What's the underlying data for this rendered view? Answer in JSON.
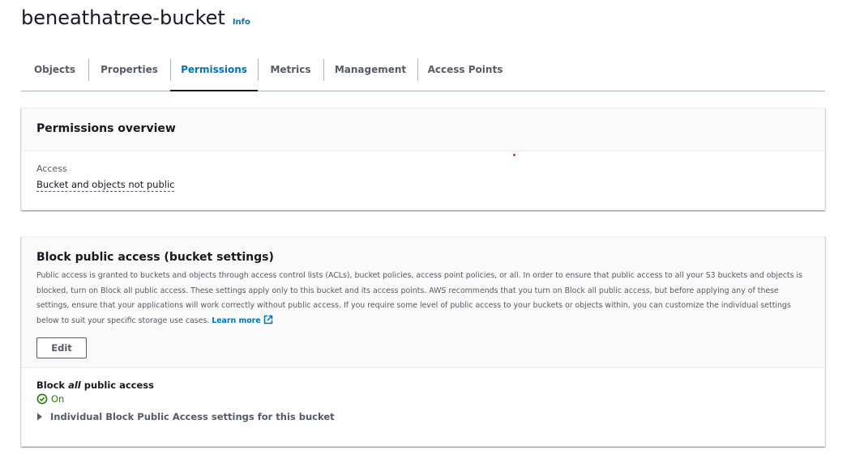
{
  "header": {
    "bucket_name": "beneathatree-bucket",
    "info_label": "Info"
  },
  "tabs": [
    {
      "label": "Objects",
      "active": false
    },
    {
      "label": "Properties",
      "active": false
    },
    {
      "label": "Permissions",
      "active": true
    },
    {
      "label": "Metrics",
      "active": false
    },
    {
      "label": "Management",
      "active": false
    },
    {
      "label": "Access Points",
      "active": false
    }
  ],
  "permissions_overview": {
    "title": "Permissions overview",
    "access_label": "Access",
    "access_value": "Bucket and objects not public"
  },
  "block_public_access": {
    "title": "Block public access (bucket settings)",
    "description": "Public access is granted to buckets and objects through access control lists (ACLs), bucket policies, access point policies, or all. In order to ensure that public access to all your S3 buckets and objects is blocked, turn on Block all public access. These settings apply only to this bucket and its access points. AWS recommends that you turn on Block all public access, but before applying any of these settings, ensure that your applications will work correctly without public access. If you require some level of public access to your buckets or objects within, you can customize the individual settings below to suit your specific storage use cases.",
    "learn_more_label": "Learn more",
    "learn_more_icon": "external-link-icon",
    "edit_label": "Edit",
    "block_all_prefix": "Block ",
    "block_all_emphasis": "all",
    "block_all_suffix": " public access",
    "status_icon": "status-positive-icon",
    "status_value": "On",
    "expander_icon": "caret-right-icon",
    "expander_label": "Individual Block Public Access settings for this bucket"
  },
  "colors": {
    "link": "#0073bb",
    "text": "#16191f",
    "secondary_text": "#545b64",
    "success": "#1d8102",
    "panel_header_bg": "#fafafa",
    "marker_dot": "#d13212"
  }
}
